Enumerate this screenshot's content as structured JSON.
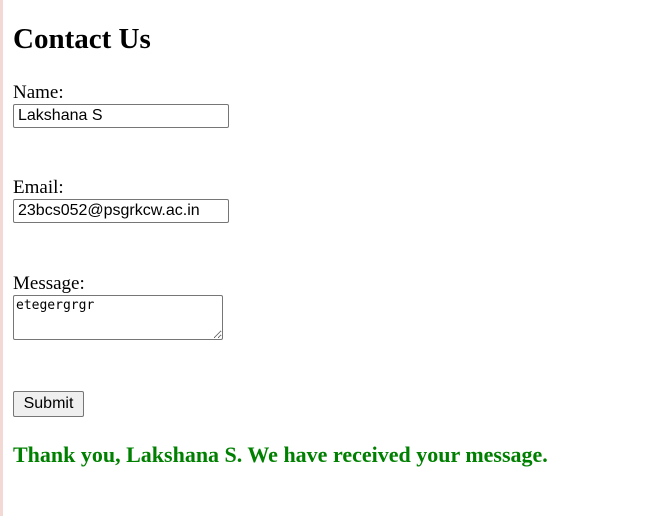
{
  "page": {
    "title": "Contact Us"
  },
  "form": {
    "name_label": "Name:",
    "name_value": "Lakshana S",
    "email_label": "Email:",
    "email_value": "23bcs052@psgrkcw.ac.in",
    "message_label": "Message:",
    "message_value": "etegergrgr",
    "submit_label": "Submit"
  },
  "confirmation": {
    "text": "Thank you, Lakshana S. We have received your message.",
    "color": "#008000"
  }
}
